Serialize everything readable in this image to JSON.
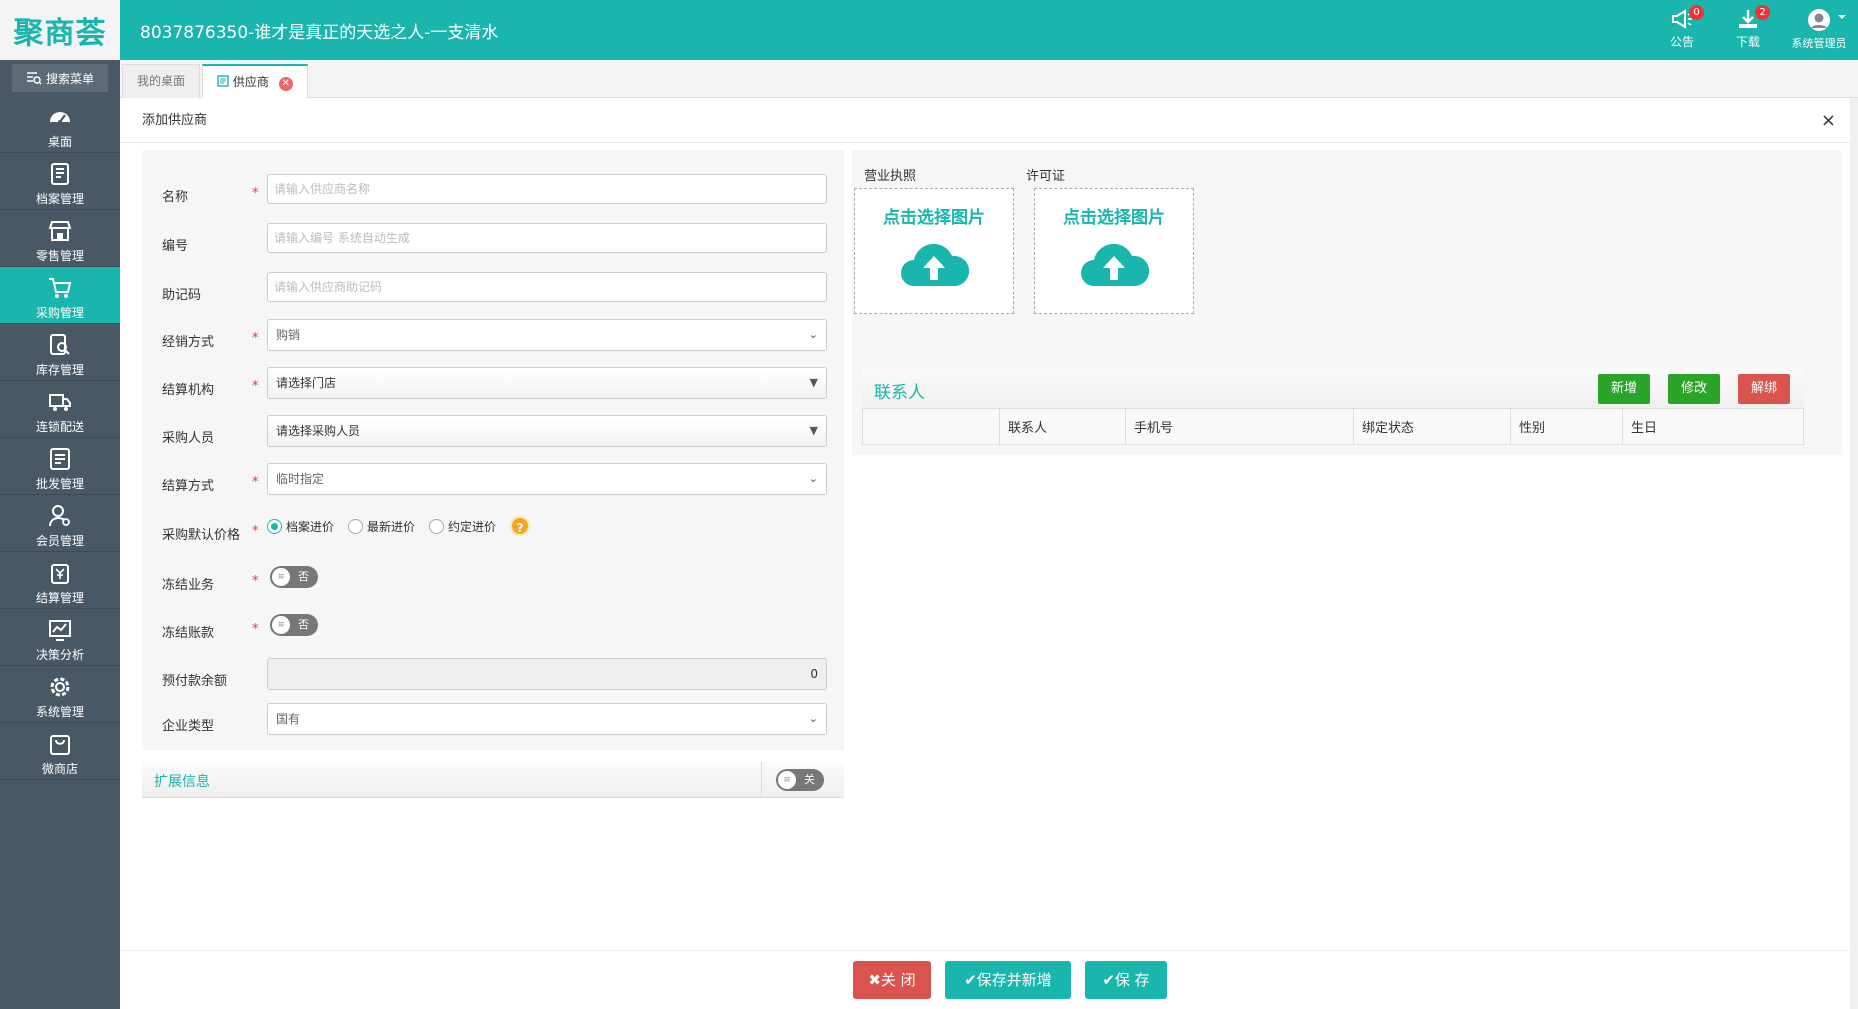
{
  "app": {
    "logo_text": "聚商荟",
    "title": "8037876350-谁才是真正的天选之人-一支清水",
    "announce_label": "公告",
    "announce_count": "0",
    "download_label": "下载",
    "download_count": "2",
    "user_label": "系统管理员"
  },
  "sidebar": {
    "search_label": "搜索菜单",
    "items": [
      {
        "label": "桌面",
        "icon": "dashboard-icon"
      },
      {
        "label": "档案管理",
        "icon": "archive-icon"
      },
      {
        "label": "零售管理",
        "icon": "store-icon"
      },
      {
        "label": "采购管理",
        "icon": "cart-icon",
        "active": true
      },
      {
        "label": "库存管理",
        "icon": "inventory-icon"
      },
      {
        "label": "连锁配送",
        "icon": "truck-icon"
      },
      {
        "label": "批发管理",
        "icon": "wholesale-icon"
      },
      {
        "label": "会员管理",
        "icon": "member-icon"
      },
      {
        "label": "结算管理",
        "icon": "settlement-icon"
      },
      {
        "label": "决策分析",
        "icon": "analysis-icon"
      },
      {
        "label": "系统管理",
        "icon": "gear-icon"
      },
      {
        "label": "微商店",
        "icon": "bag-icon"
      }
    ]
  },
  "tabs": [
    {
      "label": "我的桌面"
    },
    {
      "label": "供应商",
      "active": true
    }
  ],
  "panel": {
    "title": "添加供应商",
    "close": "×"
  },
  "form": {
    "name": {
      "label": "名称",
      "placeholder": "请输入供应商名称"
    },
    "code": {
      "label": "编号",
      "placeholder": "请输入编号 系统自动生成"
    },
    "mnemonic": {
      "label": "助记码",
      "placeholder": "请输入供应商助记码"
    },
    "sale_mode": {
      "label": "经销方式",
      "value": "购销"
    },
    "settle_org": {
      "label": "结算机构",
      "value": "请选择门店"
    },
    "buyer": {
      "label": "采购人员",
      "value": "请选择采购人员"
    },
    "settle_mode": {
      "label": "结算方式",
      "value": "临时指定"
    },
    "price": {
      "label": "采购默认价格",
      "options": [
        "档案进价",
        "最新进价",
        "约定进价"
      ],
      "selected": "档案进价",
      "help": "?"
    },
    "freeze_biz": {
      "label": "冻结业务",
      "value": "否"
    },
    "freeze_acct": {
      "label": "冻结账款",
      "value": "否"
    },
    "prepaid": {
      "label": "预付款余额",
      "value": "0"
    },
    "company_type": {
      "label": "企业类型",
      "value": "国有"
    }
  },
  "extension": {
    "title": "扩展信息",
    "toggle": "关"
  },
  "uploads": {
    "license": {
      "label": "营业执照",
      "button": "点击选择图片"
    },
    "permit": {
      "label": "许可证",
      "button": "点击选择图片"
    }
  },
  "contacts": {
    "title": "联系人",
    "add": "新增",
    "edit": "修改",
    "unbind": "解绑",
    "columns": [
      "",
      "联系人",
      "手机号",
      "绑定状态",
      "性别",
      "生日"
    ]
  },
  "footer": {
    "close": "关 闭",
    "save_new": "保存并新增",
    "save": "保 存"
  },
  "colors": {
    "accent": "#1ab5ad",
    "danger": "#d9534f",
    "success": "#2aa52a",
    "orange": "#f5a623"
  }
}
